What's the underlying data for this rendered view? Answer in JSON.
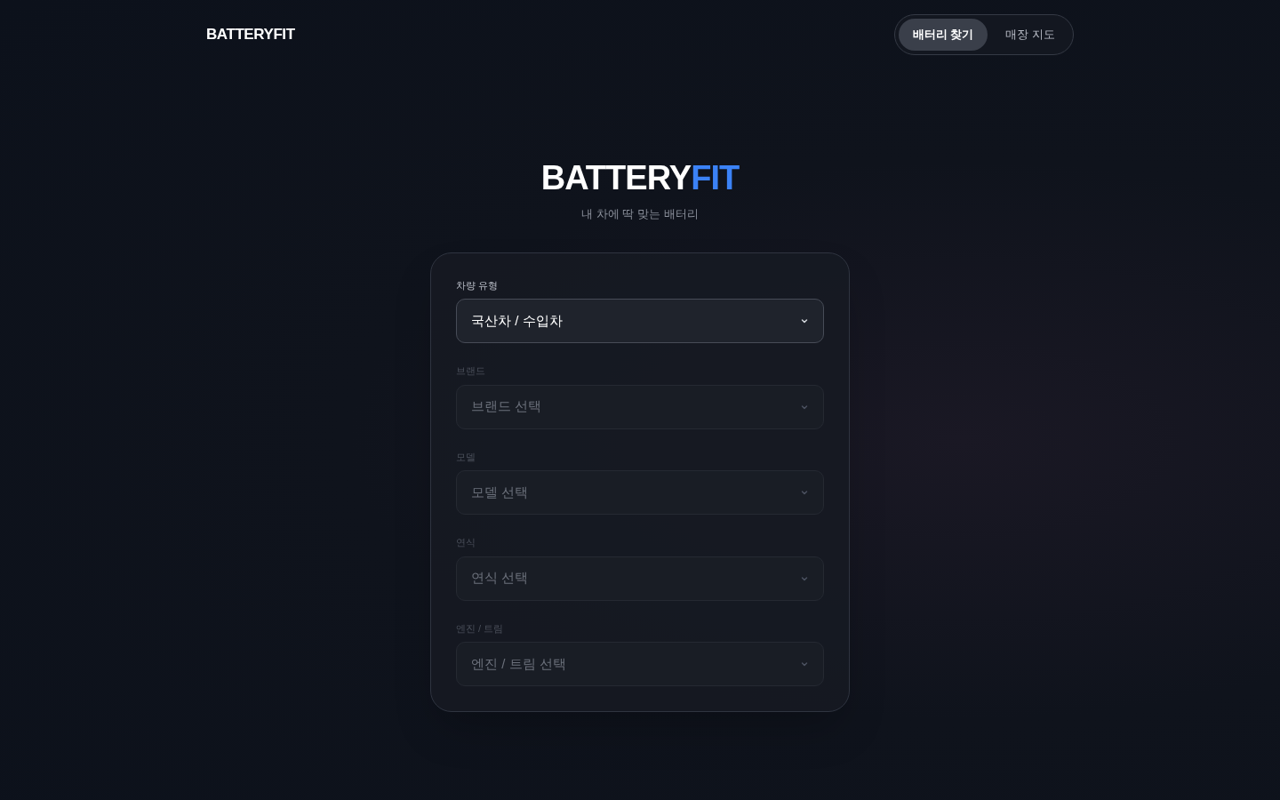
{
  "header": {
    "logo": "BATTERYFIT",
    "nav": [
      {
        "label": "배터리 찾기",
        "selected": true
      },
      {
        "label": "매장 지도",
        "selected": false
      }
    ]
  },
  "hero": {
    "title_main": "BATTERY",
    "title_accent": "FIT",
    "subtitle": "내 차에 딱 맞는 배터리"
  },
  "form": {
    "fields": [
      {
        "label": "차량 유형",
        "value": "국산차 / 수입차",
        "disabled": false
      },
      {
        "label": "브랜드",
        "placeholder": "브랜드 선택",
        "disabled": true
      },
      {
        "label": "모델",
        "placeholder": "모델 선택",
        "disabled": true
      },
      {
        "label": "연식",
        "placeholder": "연식 선택",
        "disabled": true
      },
      {
        "label": "엔진 / 트림",
        "placeholder": "엔진 / 트림 선택",
        "disabled": true
      }
    ]
  }
}
